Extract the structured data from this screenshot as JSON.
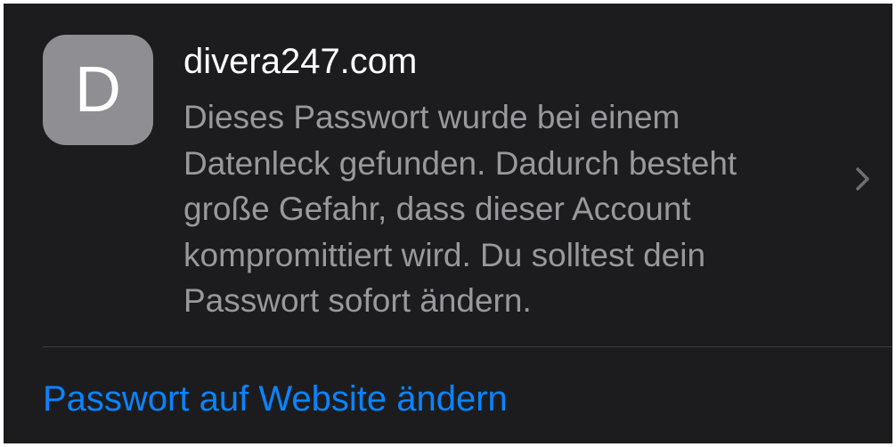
{
  "entry": {
    "avatar_letter": "D",
    "title": "divera247.com",
    "message_lines": [
      "Dieses Passwort wurde bei einem",
      "Datenleck gefunden. Dadurch besteht",
      "große Gefahr, dass dieser Account",
      "kompromittiert wird. Du solltest dein",
      "Passwort sofort ändern."
    ],
    "chevron_icon": "chevron-right-icon"
  },
  "action": {
    "label": "Passwort auf Website ändern"
  },
  "colors": {
    "background": "#1c1c1e",
    "avatar": "#8e8e93",
    "title": "#ffffff",
    "message": "#98989d",
    "accent": "#0a84ff",
    "separator": "#3a3a3c"
  }
}
